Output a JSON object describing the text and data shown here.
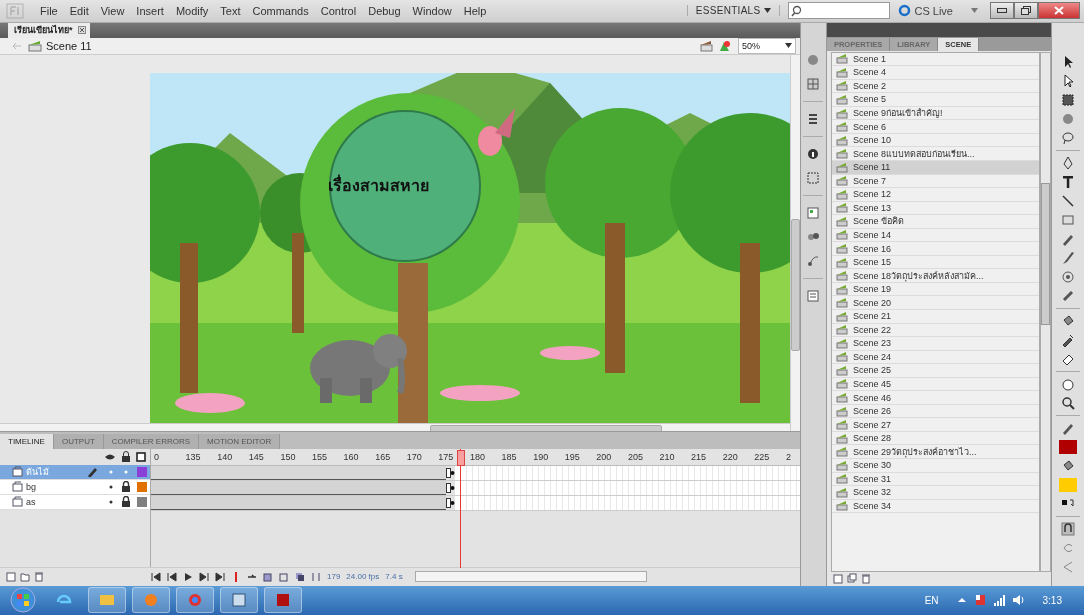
{
  "menu": [
    "File",
    "Edit",
    "View",
    "Insert",
    "Modify",
    "Text",
    "Commands",
    "Control",
    "Debug",
    "Window",
    "Help"
  ],
  "workspace": {
    "label": "ESSENTIALS",
    "cs_live": "CS Live"
  },
  "document_tab": {
    "title": "เรียนเขียนไทย*"
  },
  "scene_bar": {
    "scene": "Scene 11",
    "zoom": "50%"
  },
  "stage": {
    "title": "เรื่องสามสหาย"
  },
  "timeline": {
    "tabs": [
      {
        "label": "TIMELINE",
        "selected": true
      },
      {
        "label": "OUTPUT",
        "selected": false
      },
      {
        "label": "COMPILER ERRORS",
        "selected": false
      },
      {
        "label": "MOTION EDITOR",
        "selected": false
      }
    ],
    "ruler": [
      "0",
      "135",
      "140",
      "145",
      "150",
      "155",
      "160",
      "165",
      "170",
      "175",
      "180",
      "185",
      "190",
      "195",
      "200",
      "205",
      "210",
      "215",
      "220",
      "225",
      "2"
    ],
    "layers": [
      {
        "name": "ต้นไม้",
        "selected": true,
        "locked": false,
        "color": "#8a3fd6"
      },
      {
        "name": "bg",
        "selected": false,
        "locked": true,
        "color": "#e07000"
      },
      {
        "name": "as",
        "selected": false,
        "locked": true,
        "color": "#808080"
      }
    ],
    "current_frame": "179",
    "fps": "24.00 fps",
    "time": "7.4 s"
  },
  "panel": {
    "tabs": [
      {
        "label": "PROPERTIES",
        "selected": false
      },
      {
        "label": "LIBRARY",
        "selected": false
      },
      {
        "label": "SCENE",
        "selected": true
      }
    ],
    "scenes": [
      {
        "name": "Scene 1",
        "selected": false
      },
      {
        "name": "Scene 4",
        "selected": false
      },
      {
        "name": "Scene 2",
        "selected": false
      },
      {
        "name": "Scene 5",
        "selected": false
      },
      {
        "name": "Scene 9ก่อนเข้าสำคัญ!",
        "selected": false
      },
      {
        "name": "Scene 6",
        "selected": false
      },
      {
        "name": "Scene 10",
        "selected": false
      },
      {
        "name": "Scene 8แบบทดสอบก่อนเรียน...",
        "selected": false
      },
      {
        "name": "Scene 11",
        "selected": true
      },
      {
        "name": "Scene 7",
        "selected": false
      },
      {
        "name": "Scene 12",
        "selected": false
      },
      {
        "name": "Scene 13",
        "selected": false
      },
      {
        "name": "Scene ข้อคิด",
        "selected": false
      },
      {
        "name": "Scene 14",
        "selected": false
      },
      {
        "name": "Scene 16",
        "selected": false
      },
      {
        "name": "Scene 15",
        "selected": false
      },
      {
        "name": "Scene 18วัตถุประสงค์หลังสามัค...",
        "selected": false
      },
      {
        "name": "Scene 19",
        "selected": false
      },
      {
        "name": "Scene 20",
        "selected": false
      },
      {
        "name": "Scene 21",
        "selected": false
      },
      {
        "name": "Scene 22",
        "selected": false
      },
      {
        "name": "Scene 23",
        "selected": false
      },
      {
        "name": "Scene 24",
        "selected": false
      },
      {
        "name": "Scene 25",
        "selected": false
      },
      {
        "name": "Scene 45",
        "selected": false
      },
      {
        "name": "Scene 46",
        "selected": false
      },
      {
        "name": "Scene 26",
        "selected": false
      },
      {
        "name": "Scene 27",
        "selected": false
      },
      {
        "name": "Scene 28",
        "selected": false
      },
      {
        "name": "Scene 29วัตถุประสงค์อาชาไว...",
        "selected": false
      },
      {
        "name": "Scene 30",
        "selected": false
      },
      {
        "name": "Scene 31",
        "selected": false
      },
      {
        "name": "Scene 32",
        "selected": false
      },
      {
        "name": "Scene 34",
        "selected": false
      }
    ]
  },
  "taskbar": {
    "language": "EN",
    "time": "3:13"
  }
}
